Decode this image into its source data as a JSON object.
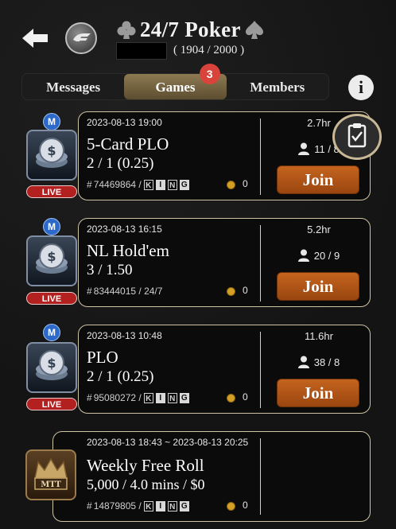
{
  "header": {
    "title": "24/7 Poker",
    "member_count": "( 1904 / 2000 )"
  },
  "tabs": [
    {
      "label": "Messages",
      "active": false
    },
    {
      "label": "Games",
      "active": true,
      "badge": "3"
    },
    {
      "label": "Members",
      "active": false
    }
  ],
  "info_label": "i",
  "games": [
    {
      "datetime": "2023-08-13 19:00",
      "name": "5-Card PLO",
      "stakes": "2 / 1 (0.25)",
      "id_prefix": "#",
      "id": "74469864 / ",
      "tags": [
        "K",
        "I",
        "N",
        "G"
      ],
      "coins": "0",
      "duration": "2.7hr",
      "players": "11 / 8",
      "join_label": "Join",
      "live_label": "LIVE",
      "m_label": "M"
    },
    {
      "datetime": "2023-08-13 16:15",
      "name": "NL Hold'em",
      "stakes": "3 / 1.50",
      "id_prefix": "#",
      "id": "83444015 / 24/7",
      "tags": [],
      "coins": "0",
      "duration": "5.2hr",
      "players": "20 / 9",
      "join_label": "Join",
      "live_label": "LIVE",
      "m_label": "M"
    },
    {
      "datetime": "2023-08-13 10:48",
      "name": "PLO",
      "stakes": "2 / 1 (0.25)",
      "id_prefix": "#",
      "id": "95080272 / ",
      "tags": [
        "K",
        "I",
        "N",
        "G"
      ],
      "coins": "0",
      "duration": "11.6hr",
      "players": "38 / 8",
      "join_label": "Join",
      "live_label": "LIVE",
      "m_label": "M"
    }
  ],
  "tournament": {
    "datetime": "2023-08-13 18:43 ~ 2023-08-13 20:25",
    "name": "Weekly Free Roll",
    "details": "5,000 / 4.0 mins / $0",
    "id_prefix": "#",
    "id": "14879805 / ",
    "tags": [
      "K",
      "I",
      "N",
      "G"
    ],
    "coins": "0",
    "icon_label": "MTT"
  },
  "colors": {
    "accent_gold": "#cfc3a3",
    "join_orange": "#b3561a",
    "live_red": "#b32020",
    "badge_red": "#d8443c",
    "m_blue": "#2c69c8"
  }
}
